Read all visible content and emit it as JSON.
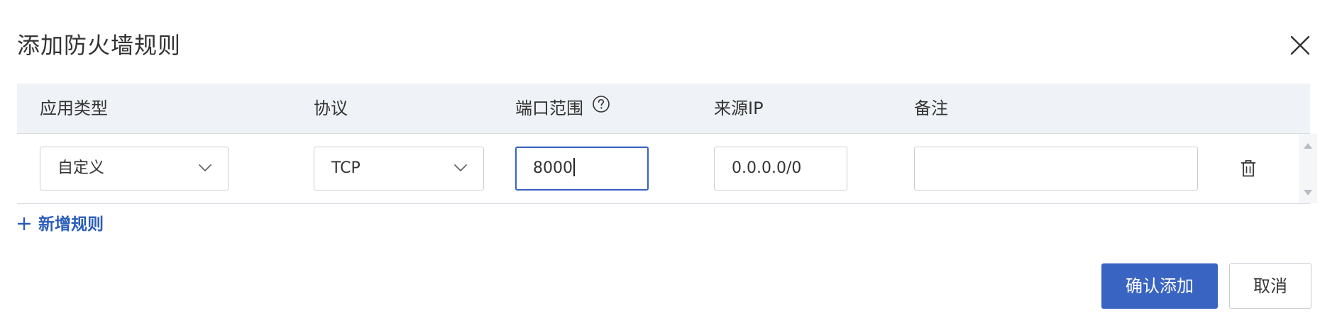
{
  "dialog": {
    "title": "添加防火墙规则",
    "close_icon": "close-icon"
  },
  "table": {
    "headers": {
      "app_type": "应用类型",
      "protocol": "协议",
      "port_range": "端口范围",
      "source_ip": "来源IP",
      "remark": "备注"
    },
    "row": {
      "app_type_value": "自定义",
      "protocol_value": "TCP",
      "port_value": "8000",
      "source_ip_value": "0.0.0.0/0",
      "remark_value": ""
    }
  },
  "add_rule": {
    "label": "新增规则",
    "icon": "plus-icon"
  },
  "footer": {
    "confirm_label": "确认添加",
    "cancel_label": "取消"
  },
  "colors": {
    "accent": "#3a64c2",
    "link": "#2b5db8",
    "header_bg": "#eff2f6",
    "border": "#c9cdd3"
  }
}
